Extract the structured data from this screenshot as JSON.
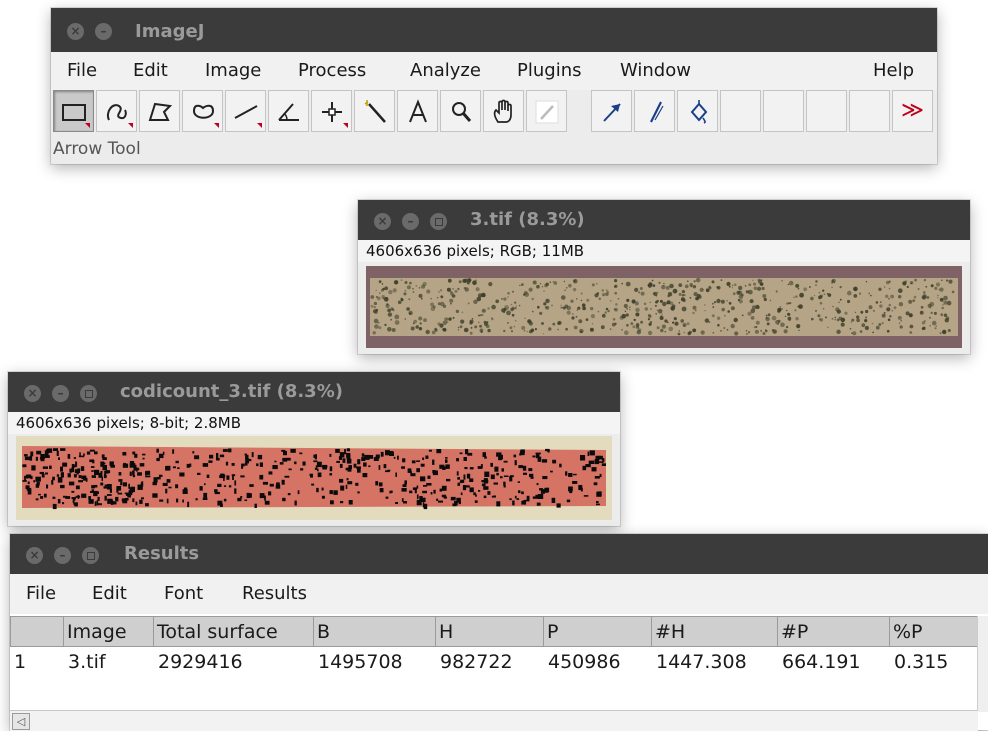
{
  "imagej": {
    "title": "ImageJ",
    "menu": [
      "File",
      "Edit",
      "Image",
      "Process",
      "Analyze",
      "Plugins",
      "Window",
      "Help"
    ],
    "status": "Arrow Tool",
    "tools": [
      "rectangle-tool",
      "freehand-tool",
      "polygon-tool",
      "oval-tool",
      "line-tool",
      "angle-tool",
      "point-tool",
      "wand-tool",
      "text-tool",
      "magnifier-tool",
      "hand-tool",
      "color-picker-tool",
      "arrow-tool",
      "brush-tool",
      "flood-fill-tool"
    ],
    "more_glyph": "≫",
    "accent": "#c0001a"
  },
  "image_rgb": {
    "title": "3.tif (8.3%)",
    "info": "4606x636 pixels; RGB; 11MB"
  },
  "image_codicount": {
    "title": "codicount_3.tif (8.3%)",
    "info": "4606x636 pixels; 8-bit; 2.8MB"
  },
  "results": {
    "title": "Results",
    "menu": [
      "File",
      "Edit",
      "Font",
      "Results"
    ],
    "columns": [
      "",
      "Image",
      "Total surface",
      "B",
      "H",
      "P",
      "#H",
      "#P",
      "%P"
    ],
    "rows": [
      [
        "1",
        "3.tif",
        "2929416",
        "1495708",
        "982722",
        "450986",
        "1447.308",
        "664.191",
        "0.315"
      ]
    ]
  },
  "window_button_glyphs": {
    "close": "×",
    "minimize": "–"
  }
}
